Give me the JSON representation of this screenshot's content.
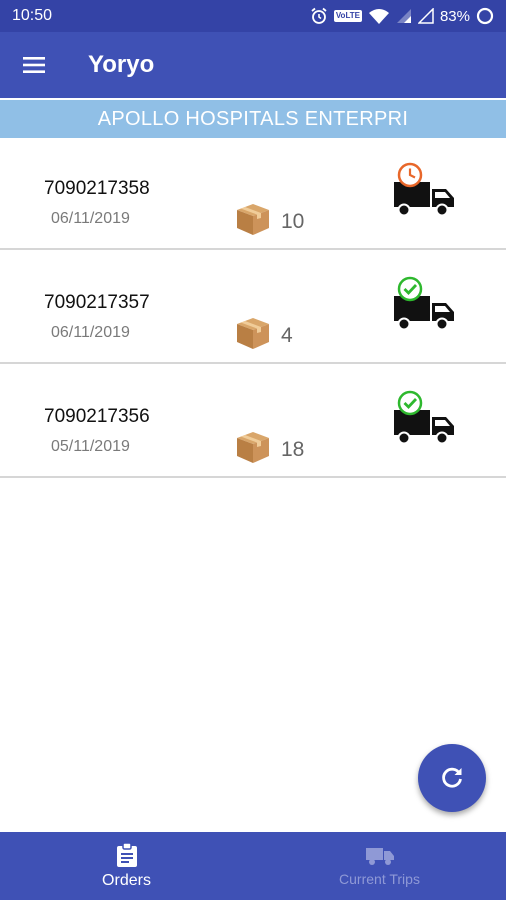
{
  "status_bar": {
    "time": "10:50",
    "network_badge": "VoLTE",
    "battery": "83%",
    "icons": [
      "alarm-icon",
      "wifi-icon",
      "signal-icon",
      "battery-icon"
    ]
  },
  "app_bar": {
    "title": "Yoryo",
    "menu_icon": "menu-icon"
  },
  "banner": {
    "company": "APOLLO HOSPITALS ENTERPRI"
  },
  "orders": [
    {
      "id": "7090217358",
      "date": "06/11/2019",
      "qty": "10",
      "status_icon": "pending-clock-icon"
    },
    {
      "id": "7090217357",
      "date": "06/11/2019",
      "qty": "4",
      "status_icon": "delivered-check-icon"
    },
    {
      "id": "7090217356",
      "date": "05/11/2019",
      "qty": "18",
      "status_icon": "delivered-check-icon"
    }
  ],
  "fab": {
    "icon": "refresh-icon"
  },
  "bottom_nav": {
    "items": [
      {
        "label": "Orders",
        "icon": "clipboard-icon",
        "active": true
      },
      {
        "label": "Current Trips",
        "icon": "truck-icon",
        "active": false
      }
    ]
  },
  "colors": {
    "primary": "#3f51b5",
    "status_bar": "#3443a6",
    "banner": "#90bfe6",
    "pending": "#e8672a",
    "delivered": "#2eb82e"
  }
}
